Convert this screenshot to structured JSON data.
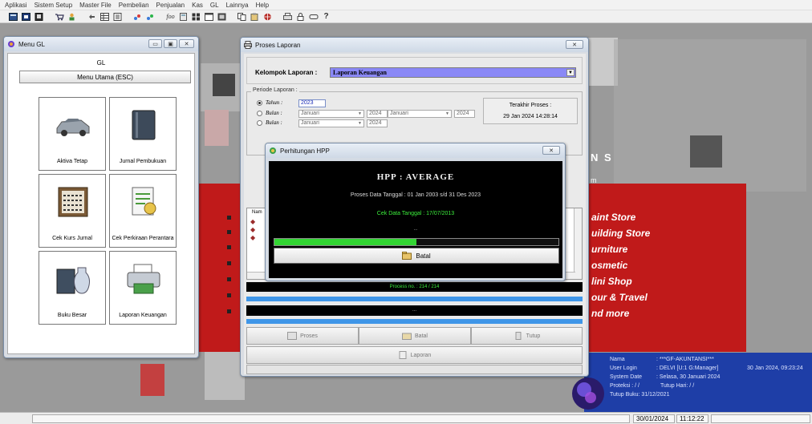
{
  "menubar": {
    "items": [
      "Aplikasi",
      "Sistem Setup",
      "Master File",
      "Pembelian",
      "Penjualan",
      "Kas",
      "GL",
      "Lainnya",
      "Help"
    ]
  },
  "toolbar": {
    "icons": [
      "calculator-icon",
      "grid-icon",
      "report-icon",
      "sep",
      "cart-icon",
      "person-icon",
      "sep",
      "undo-icon",
      "table-icon",
      "doc-icon",
      "sep",
      "pin-icon",
      "pin2-icon",
      "sep",
      "function-icon",
      "calc-icon",
      "grid2-icon",
      "cal-icon",
      "box-icon",
      "sep",
      "copy-icon",
      "paste-icon",
      "web-icon",
      "sep",
      "print-icon",
      "lock-icon",
      "key-icon",
      "help-icon"
    ],
    "help_glyph": "?"
  },
  "menu_gl": {
    "title": "Menu GL",
    "heading": "GL",
    "main_button": "Menu Utama (ESC)",
    "tiles": [
      {
        "label": "Aktiva Tetap",
        "icon": "car-icon"
      },
      {
        "label": "Jurnal Pembukuan",
        "icon": "ledger-book-icon"
      },
      {
        "label": "Cek Kurs Jurnal",
        "icon": "abacus-icon"
      },
      {
        "label": "Cek Perkiraan Perantara",
        "icon": "checklist-icon"
      },
      {
        "label": "Buku Besar",
        "icon": "vase-book-icon"
      },
      {
        "label": "Laporan Keuangan",
        "icon": "printer-icon"
      }
    ]
  },
  "proses_laporan": {
    "title": "Proses Laporan",
    "kelompok_label": "Kelompok Laporan :",
    "kelompok_value": "Laporan Keuangan",
    "periode_label": "Periode Laporan :",
    "radio_tahun": "Tahun :",
    "tahun_value": "2023",
    "radio_bulan1": "Bulan :",
    "bulan1_month": "Januari",
    "bulan1_year": "2024",
    "bulan1_month2": "Januari",
    "bulan1_year2": "2024",
    "radio_bulan2": "Bulan :",
    "bulan2_month": "Januari",
    "bulan2_year": "2024",
    "terakhir_label": "Terakhir Proses :",
    "terakhir_value": "29 Jan 2024  14:28:14",
    "list_header": "Nam",
    "process_no": "Process no. : 214 / 214",
    "ellipsis": "...",
    "btn_proses": "Proses",
    "btn_batal": "Batal",
    "btn_tutup": "Tutup",
    "btn_laporan": "Laporan"
  },
  "hpp_dialog": {
    "title": "Perhitungan HPP",
    "heading": "HPP  :  AVERAGE",
    "proses_text": "Proses Data Tanggal : 01 Jan 2003 s/d 31 Des 2023",
    "cek_text": "Cek Data Tanggal : 17/07/2013",
    "dots": "...",
    "progress": 0.5,
    "batal": "Batal"
  },
  "background": {
    "fragment_ns": "N S",
    "fragment_m": "m",
    "features": [
      "aint Store",
      "uilding Store",
      "urniture",
      "osmetic",
      "lini Shop",
      "our & Travel",
      "nd more"
    ]
  },
  "user_info": {
    "nama_label": "Nama",
    "nama_value": ": ***GF-AKUNTANSI***",
    "login_label": "User Login",
    "login_value": ": DELVI [U:1 G:Manager]",
    "login_time": "30 Jan 2024, 09:23:24",
    "sysdate_label": "System Date",
    "sysdate_value": ": Selasa, 30 Januari 2024",
    "proteksi": "Proteksi :  / /",
    "tutup_hari": "Tutup Hari:  / /",
    "tutup_buku": "Tutup Buku: 31/12/2021"
  },
  "statusbar": {
    "date": "30/01/2024",
    "time": "11:12:22"
  },
  "colors": {
    "accent_purple": "#8a88f6",
    "progress_green": "#33d533",
    "process_blue": "#3f96e8",
    "info_blue": "#1e3ea7",
    "red_deco": "#c01a1a"
  }
}
